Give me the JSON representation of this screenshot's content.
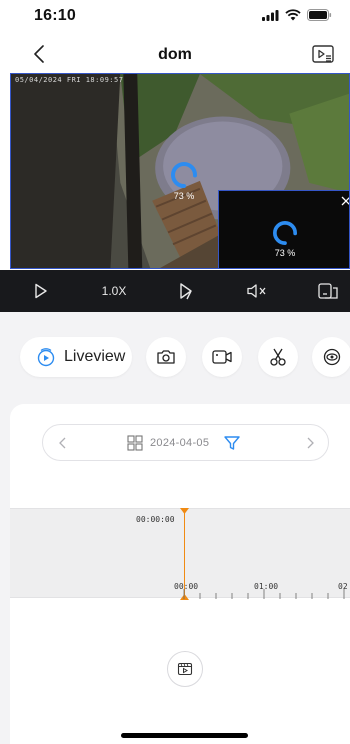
{
  "status_bar": {
    "time": "16:10"
  },
  "nav": {
    "title": "dom"
  },
  "video": {
    "osd": "05/04/2024 FRI 18:09:57",
    "main_loading": "73 %",
    "pip_loading": "73 %"
  },
  "controls": {
    "speed": "1.0X"
  },
  "tools": {
    "liveview_label": "Liveview"
  },
  "timeline": {
    "date": "2024-04-05",
    "cursor_time": "00:00:00",
    "tick_labels": [
      "00:00",
      "01:00",
      "02"
    ]
  },
  "colors": {
    "accent_blue": "#2d8cf0",
    "cursor_orange": "#f08a12",
    "control_bar": "#18191c"
  },
  "icons": {
    "back": "chevron-left-icon",
    "playlist": "playlist-icon",
    "play": "play-icon",
    "frame_step": "step-icon",
    "mute": "mute-icon",
    "fullscreen": "fullscreen-icon",
    "snapshot": "camera-icon",
    "record": "record-icon",
    "cut": "scissors-icon",
    "fisheye": "eye-icon",
    "filter": "filter-icon",
    "calendar_grid": "grid-icon",
    "clip_list": "clip-icon"
  }
}
